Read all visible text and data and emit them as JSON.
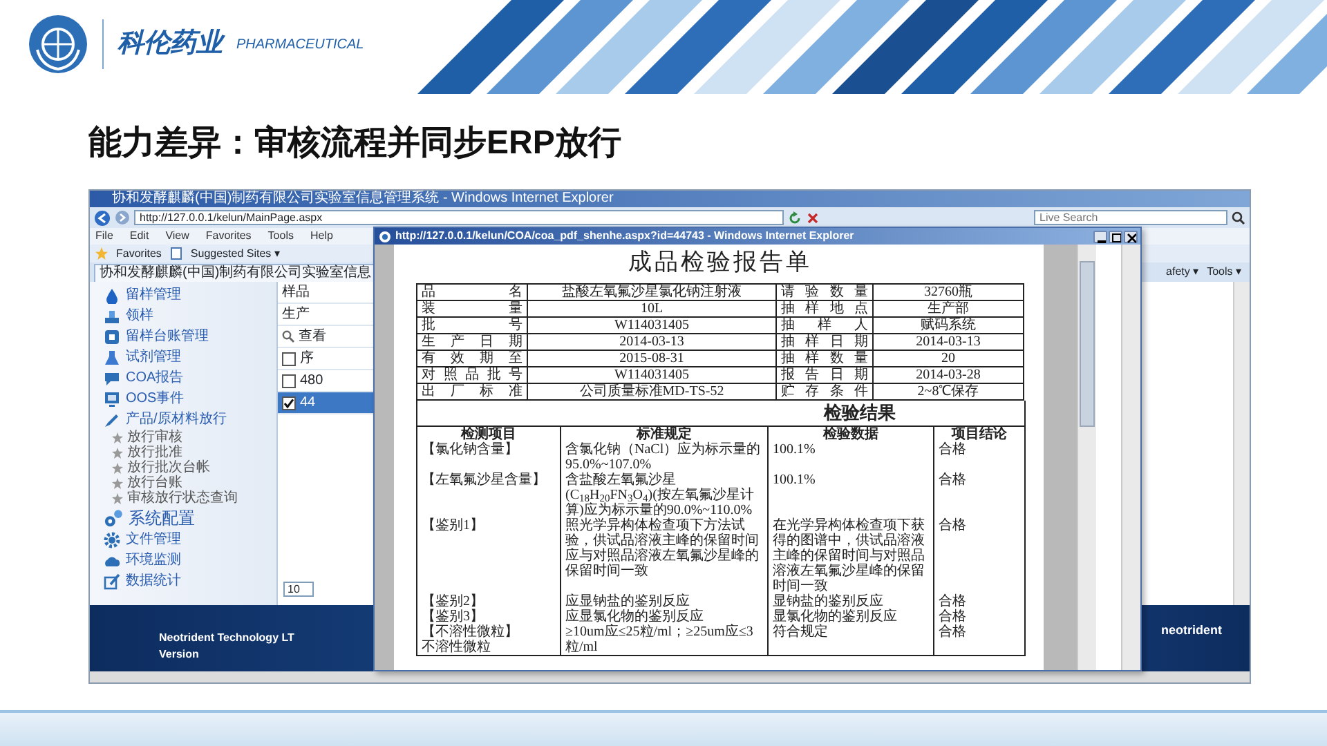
{
  "slide": {
    "brand": "科伦药业",
    "tagline": "PHARMACEUTICAL",
    "title": "能力差异：审核流程并同步ERP放行"
  },
  "main_window": {
    "title": "协和发酵麒麟(中国)制药有限公司实验室信息管理系统 - Windows Internet Explorer",
    "address": "http://127.0.0.1/kelun/MainPage.aspx",
    "search_placeholder": "Live Search",
    "menu": [
      "File",
      "Edit",
      "View",
      "Favorites",
      "Tools",
      "Help"
    ],
    "favorites": [
      "Favorites",
      "Suggested Sites ▾"
    ],
    "tab": "协和发酵麒麟(中国)制药有限公司实验室信息",
    "command_bar": [
      "afety ▾",
      "Tools ▾"
    ],
    "sidebar": {
      "items": [
        {
          "label": "留样管理",
          "kind": "normal"
        },
        {
          "label": "领样",
          "kind": "normal"
        },
        {
          "label": "留样台账管理",
          "kind": "normal"
        },
        {
          "label": "试剂管理",
          "kind": "normal"
        },
        {
          "label": "COA报告",
          "kind": "normal"
        },
        {
          "label": "OOS事件",
          "kind": "normal"
        },
        {
          "label": "产品/原材料放行",
          "kind": "normal",
          "children": [
            {
              "label": "放行审核"
            },
            {
              "label": "放行批准"
            },
            {
              "label": "放行批次台帐"
            },
            {
              "label": "放行台账"
            },
            {
              "label": "审核放行状态查询"
            }
          ]
        },
        {
          "label": "系统配置",
          "kind": "large"
        },
        {
          "label": "文件管理",
          "kind": "normal"
        },
        {
          "label": "环境监测",
          "kind": "normal"
        },
        {
          "label": "数据统计",
          "kind": "normal"
        }
      ]
    },
    "list_panel": {
      "labels": [
        "样品",
        "生产"
      ],
      "search_label": "查看",
      "rows": [
        {
          "text": "序",
          "checked": false,
          "selected": false
        },
        {
          "text": "480",
          "checked": false,
          "selected": false
        },
        {
          "text": "44",
          "checked": true,
          "selected": true
        }
      ],
      "page_size": "10"
    },
    "footer": {
      "company": "Neotrident Technology LT",
      "version": "Version",
      "logo": "neotrident"
    }
  },
  "popup_window": {
    "title": "http://127.0.0.1/kelun/COA/coa_pdf_shenhe.aspx?id=44743 - Windows Internet Explorer",
    "report": {
      "title": "成品检验报告单",
      "info_rows": [
        {
          "label": "品 名",
          "value": "盐酸左氧氟沙星氯化钠注射液",
          "label_2": "请验数量",
          "value_2": "32760瓶"
        },
        {
          "label": "装 量",
          "value": "10L",
          "label_2": "抽样地点",
          "value_2": "生产部"
        },
        {
          "label": "批 号",
          "value": "W114031405",
          "label_2": "抽 样 人",
          "value_2": "赋码系统"
        },
        {
          "label": "生产日期",
          "value": "2014-03-13",
          "label_2": "抽样日期",
          "value_2": "2014-03-13"
        },
        {
          "label": "有效期至",
          "value": "2015-08-31",
          "label_2": "抽样数量",
          "value_2": "20"
        },
        {
          "label": "对照品批号",
          "value": "W114031405",
          "label_2": "报告日期",
          "value_2": "2014-03-28"
        },
        {
          "label": "出厂标准",
          "value": "公司质量标准MD-TS-52",
          "label_2": "贮存条件",
          "value_2": "2~8℃保存"
        }
      ],
      "results_title": "检验结果",
      "columns": [
        "检测项目",
        "标准规定",
        "检验数据",
        "项目结论"
      ],
      "rows": [
        {
          "item": [
            "【氯化钠含量】"
          ],
          "standard": "含氯化钠（NaCl）应为标示量的95.0%~107.0%",
          "data": "100.1%",
          "conclusion": "合格"
        },
        {
          "item": [
            "【左氧氟沙星含量】"
          ],
          "standard": "含盐酸左氧氟沙星(C$_{18}$H$_{20}$FN$_{3}$O$_{4}$)(按左氧氟沙星计算)应为标示量的90.0%~110.0%",
          "data": "100.1%",
          "conclusion": "合格"
        },
        {
          "item": [
            "【鉴别1】"
          ],
          "standard": "照光学异构体检查项下方法试验，供试品溶液主峰的保留时间应与对照品溶液左氧氟沙星峰的保留时间一致",
          "data": "在光学异构体检查项下获得的图谱中，供试品溶液主峰的保留时间与对照品溶液左氧氟沙星峰的保留时间一致",
          "conclusion": "合格"
        },
        {
          "item": [
            "【鉴别2】"
          ],
          "standard": "应显钠盐的鉴别反应",
          "data": "显钠盐的鉴别反应",
          "conclusion": "合格"
        },
        {
          "item": [
            "【鉴别3】"
          ],
          "standard": "应显氯化物的鉴别反应",
          "data": "显氯化物的鉴别反应",
          "conclusion": "合格"
        },
        {
          "item": [
            "【不溶性微粒】",
            "不溶性微粒"
          ],
          "standard": "≥10um应≤25粒/ml；≥25um应≤3粒/ml",
          "data": "符合规定",
          "conclusion": "合格"
        }
      ]
    }
  }
}
